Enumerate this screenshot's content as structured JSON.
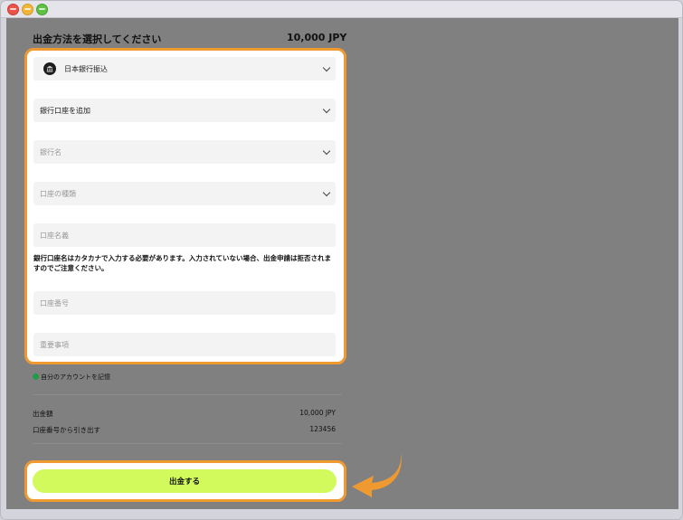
{
  "page": {
    "heading": "出金方法を選択してください",
    "amount": "10,000 JPY"
  },
  "form": {
    "method": {
      "value": "日本銀行振込",
      "icon": "bank-icon"
    },
    "account_select": {
      "value": "銀行口座を追加"
    },
    "bank_name": {
      "placeholder": "銀行名"
    },
    "account_type": {
      "placeholder": "口座の種類"
    },
    "account_holder": {
      "placeholder": "口座名義"
    },
    "notice": "銀行口座名はカタカナで入力する必要があります。入力されていない場合、出金申請は拒否されますのでご注意ください。",
    "account_number": {
      "placeholder": "口座番号"
    },
    "important_notes": {
      "placeholder": "重要事項"
    }
  },
  "remember": {
    "label": "自分のアカウントを記憶",
    "checked": true
  },
  "summary": {
    "rows": [
      {
        "label": "出金額",
        "value": "10,000 JPY"
      },
      {
        "label": "口座番号から引き出す",
        "value": "123456"
      }
    ]
  },
  "submit": {
    "label": "出金する"
  },
  "colors": {
    "highlight": "#ee9a31",
    "button": "#d3fa5d",
    "background": "#808080",
    "checkbox": "#239a4a"
  }
}
